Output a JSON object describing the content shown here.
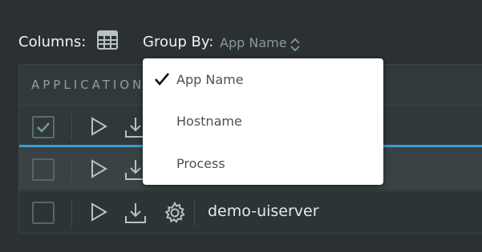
{
  "toolbar": {
    "columns_label": "Columns:",
    "group_by_label": "Group By:",
    "group_by_value": "App Name"
  },
  "table": {
    "header": "APPLICATION",
    "rows": [
      {
        "checked": true,
        "name": ""
      },
      {
        "checked": false,
        "name": ""
      },
      {
        "checked": false,
        "name": "demo-uiserver"
      }
    ]
  },
  "dropdown": {
    "options": [
      {
        "label": "App Name",
        "selected": true
      },
      {
        "label": "Hostname",
        "selected": false
      },
      {
        "label": "Process",
        "selected": false
      }
    ]
  },
  "colors": {
    "background": "#2b3133",
    "accent": "#3e9bd4",
    "check_green": "#6fa88a"
  }
}
